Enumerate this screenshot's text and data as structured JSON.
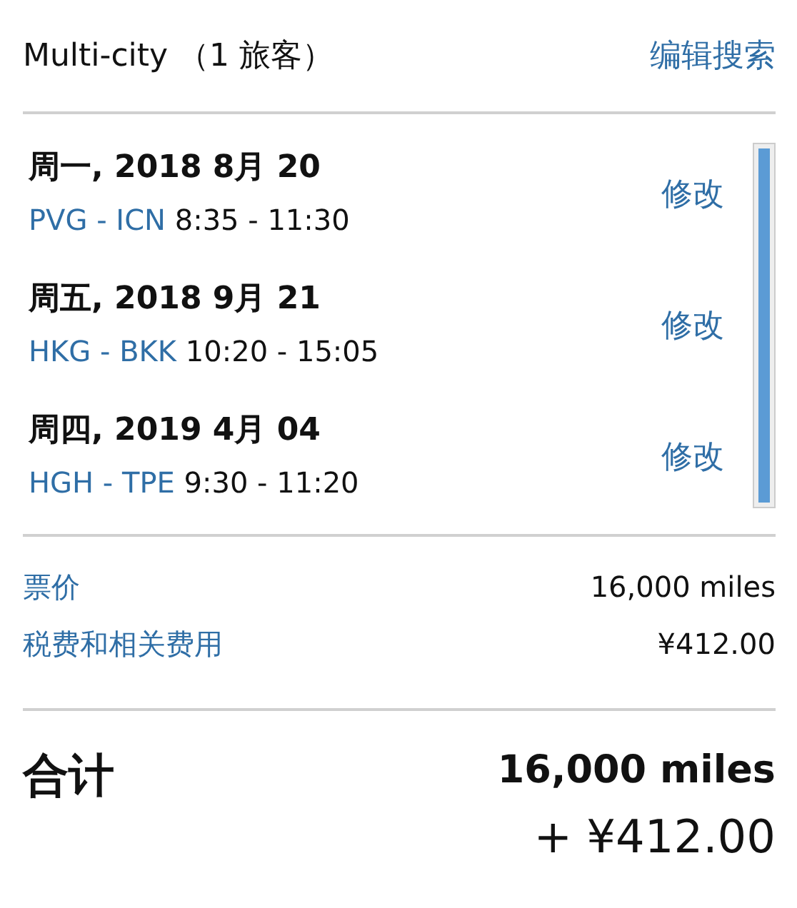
{
  "header": {
    "title": "Multi-city （1 旅客）",
    "edit_search": "编辑搜索"
  },
  "segments": [
    {
      "date": "周一, 2018 8月 20",
      "route": "PVG - ICN",
      "times": "8:35 - 11:30",
      "change": "修改"
    },
    {
      "date": "周五, 2018 9月 21",
      "route": "HKG - BKK",
      "times": "10:20 - 15:05",
      "change": "修改"
    },
    {
      "date": "周四, 2019 4月 04",
      "route": "HGH - TPE",
      "times": "9:30 - 11:20",
      "change": "修改"
    }
  ],
  "fares": [
    {
      "label": "票价",
      "value": "16,000 miles"
    },
    {
      "label": "税费和相关费用",
      "value": "¥412.00"
    }
  ],
  "total": {
    "label": "合计",
    "miles": "16,000 miles",
    "cash": "+ ¥412.00"
  }
}
